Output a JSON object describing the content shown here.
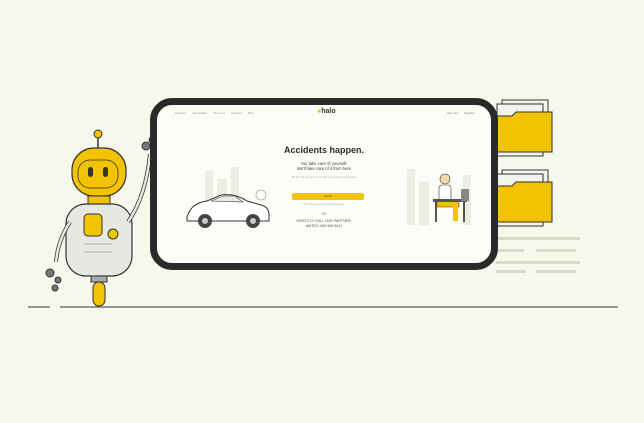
{
  "nav": {
    "left_items": [
      "Services",
      "Specialists",
      "About Us",
      "Careers",
      "Blog"
    ],
    "brand": "halo",
    "right_items": [
      "Sign Up",
      "Register"
    ]
  },
  "hero": {
    "headline": "Accidents happen.",
    "subline_1": "You take care of yourself.",
    "subline_2": "We'll take care of it from here",
    "hint": "Be the 1st, we are here to help - just send us our details",
    "cta_label": "Log In",
    "cta_sub": "Don't have an account? Register here",
    "or_label": "OR",
    "call_line_1": "DIRECTLY CALL OUR PARTNER,",
    "call_line_2": "AMTEC: 689 566 5411"
  },
  "colors": {
    "accent": "#f3c300",
    "background": "#f7f8ec",
    "ink": "#2a2a2a"
  },
  "icons": [
    "robot-illustration",
    "car-illustration",
    "person-on-bench-illustration",
    "folder-icon",
    "folder-icon"
  ]
}
